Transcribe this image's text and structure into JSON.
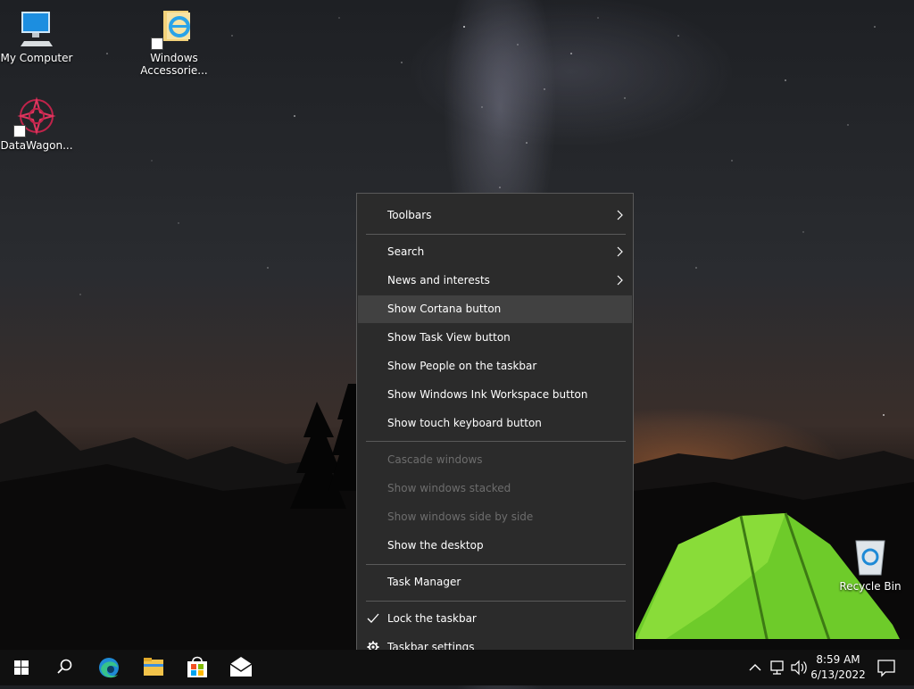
{
  "desktop": {
    "icons": [
      {
        "label": "My Computer"
      },
      {
        "label": "Windows Accessorie..."
      },
      {
        "label": "DataWagon..."
      },
      {
        "label": "Recycle Bin"
      }
    ]
  },
  "context_menu": {
    "items": [
      {
        "label": "Toolbars",
        "submenu": true
      },
      {
        "label": "Search",
        "submenu": true
      },
      {
        "label": "News and interests",
        "submenu": true
      },
      {
        "label": "Show Cortana button",
        "highlighted": true
      },
      {
        "label": "Show Task View button"
      },
      {
        "label": "Show People on the taskbar"
      },
      {
        "label": "Show Windows Ink Workspace button"
      },
      {
        "label": "Show touch keyboard button"
      },
      {
        "label": "Cascade windows",
        "disabled": true
      },
      {
        "label": "Show windows stacked",
        "disabled": true
      },
      {
        "label": "Show windows side by side",
        "disabled": true
      },
      {
        "label": "Show the desktop"
      },
      {
        "label": "Task Manager"
      },
      {
        "label": "Lock the taskbar",
        "checked": true
      },
      {
        "label": "Taskbar settings",
        "icon": "gear-icon"
      }
    ]
  },
  "taskbar": {
    "pinned": [
      "start-icon",
      "search-icon",
      "edge-icon",
      "file-explorer-icon",
      "store-icon",
      "mail-icon"
    ],
    "tray": {
      "time": "8:59 AM",
      "date": "6/13/2022"
    }
  },
  "colors": {
    "menu_bg": "#2b2b2b",
    "menu_hover": "#414141",
    "menu_disabled": "#6d6d6d",
    "taskbar_bg": "#101010",
    "edge_blue": "#1f8ad6",
    "explorer_yellow": "#f2c34a"
  }
}
